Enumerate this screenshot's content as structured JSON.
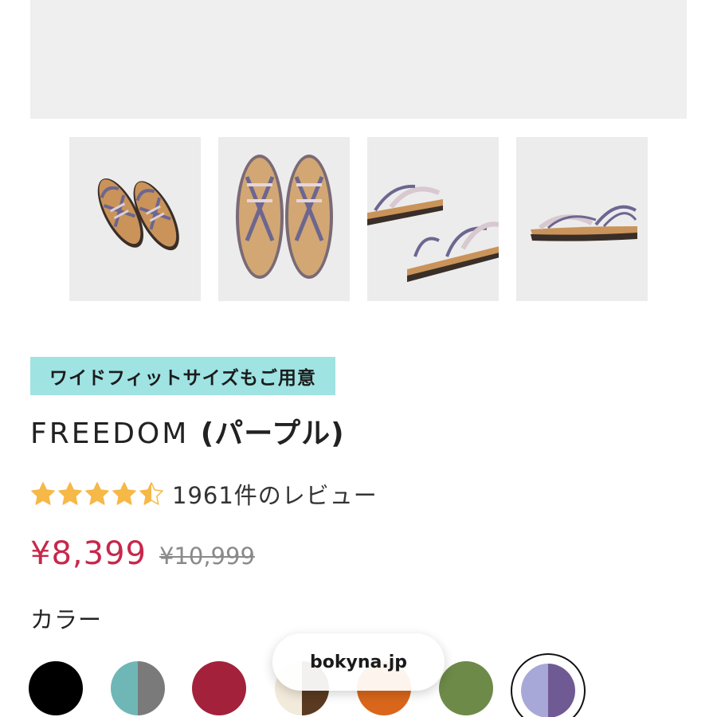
{
  "hero": {},
  "gallery": {
    "thumbnails": [
      {
        "view": "angle-pair"
      },
      {
        "view": "top-pair"
      },
      {
        "view": "side-pair"
      },
      {
        "view": "side-single"
      }
    ]
  },
  "product": {
    "badge": "ワイドフィットサイズもご用意",
    "name": "FREEDOM",
    "color_name": "(パープル)",
    "rating": 4.5,
    "review_text": "1961件のレビュー",
    "price": "¥8,399",
    "original_price": "¥10,999",
    "accent_color": "#c8274b",
    "star_color": "#f6b847",
    "badge_color": "#9fe3e3"
  },
  "colors": {
    "label": "カラー",
    "swatches": [
      {
        "name": "black",
        "hex": "#000000"
      },
      {
        "name": "teal-gray",
        "hex": "#6fb7b6"
      },
      {
        "name": "red",
        "hex": "#a3213a"
      },
      {
        "name": "cream-brown",
        "hex": "#f2eadb"
      },
      {
        "name": "orange",
        "hex": "#d9661a"
      },
      {
        "name": "green",
        "hex": "#6d8a48"
      },
      {
        "name": "purple",
        "hex": "#a8a8d8",
        "selected": true
      }
    ]
  },
  "watermark": {
    "text": "bokyna.jp"
  }
}
